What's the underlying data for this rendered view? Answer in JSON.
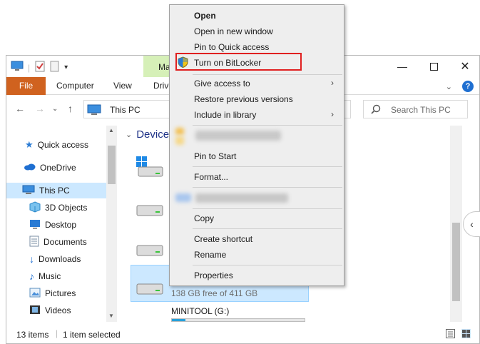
{
  "window": {
    "title_tab": "Ma",
    "ribbon_tabs": [
      "File",
      "Computer",
      "View",
      "Drive"
    ],
    "address": "This PC",
    "search_placeholder": "Search This PC"
  },
  "nav": {
    "items": [
      "Quick access",
      "OneDrive",
      "This PC",
      "3D Objects",
      "Desktop",
      "Documents",
      "Downloads",
      "Music",
      "Pictures",
      "Videos"
    ]
  },
  "content": {
    "group_header": "Devices",
    "selected_drive_free": "138 GB free of 411 GB",
    "next_drive_name": "MINITOOL (G:)"
  },
  "drive_usage": {
    "next_drive_used_fraction": 0.1
  },
  "status": {
    "count": "13 items",
    "selection": "1 item selected"
  },
  "context_menu": {
    "open": "Open",
    "open_new_window": "Open in new window",
    "pin_quick_access": "Pin to Quick access",
    "bitlocker": "Turn on BitLocker",
    "give_access": "Give access to",
    "restore": "Restore previous versions",
    "include_library": "Include in library",
    "pin_start": "Pin to Start",
    "format": "Format...",
    "copy": "Copy",
    "create_shortcut": "Create shortcut",
    "rename": "Rename",
    "properties": "Properties"
  },
  "colors": {
    "accent": "#d0621f",
    "selection": "#cce8ff",
    "highlight_box": "#e02020",
    "link": "#1e3287"
  }
}
